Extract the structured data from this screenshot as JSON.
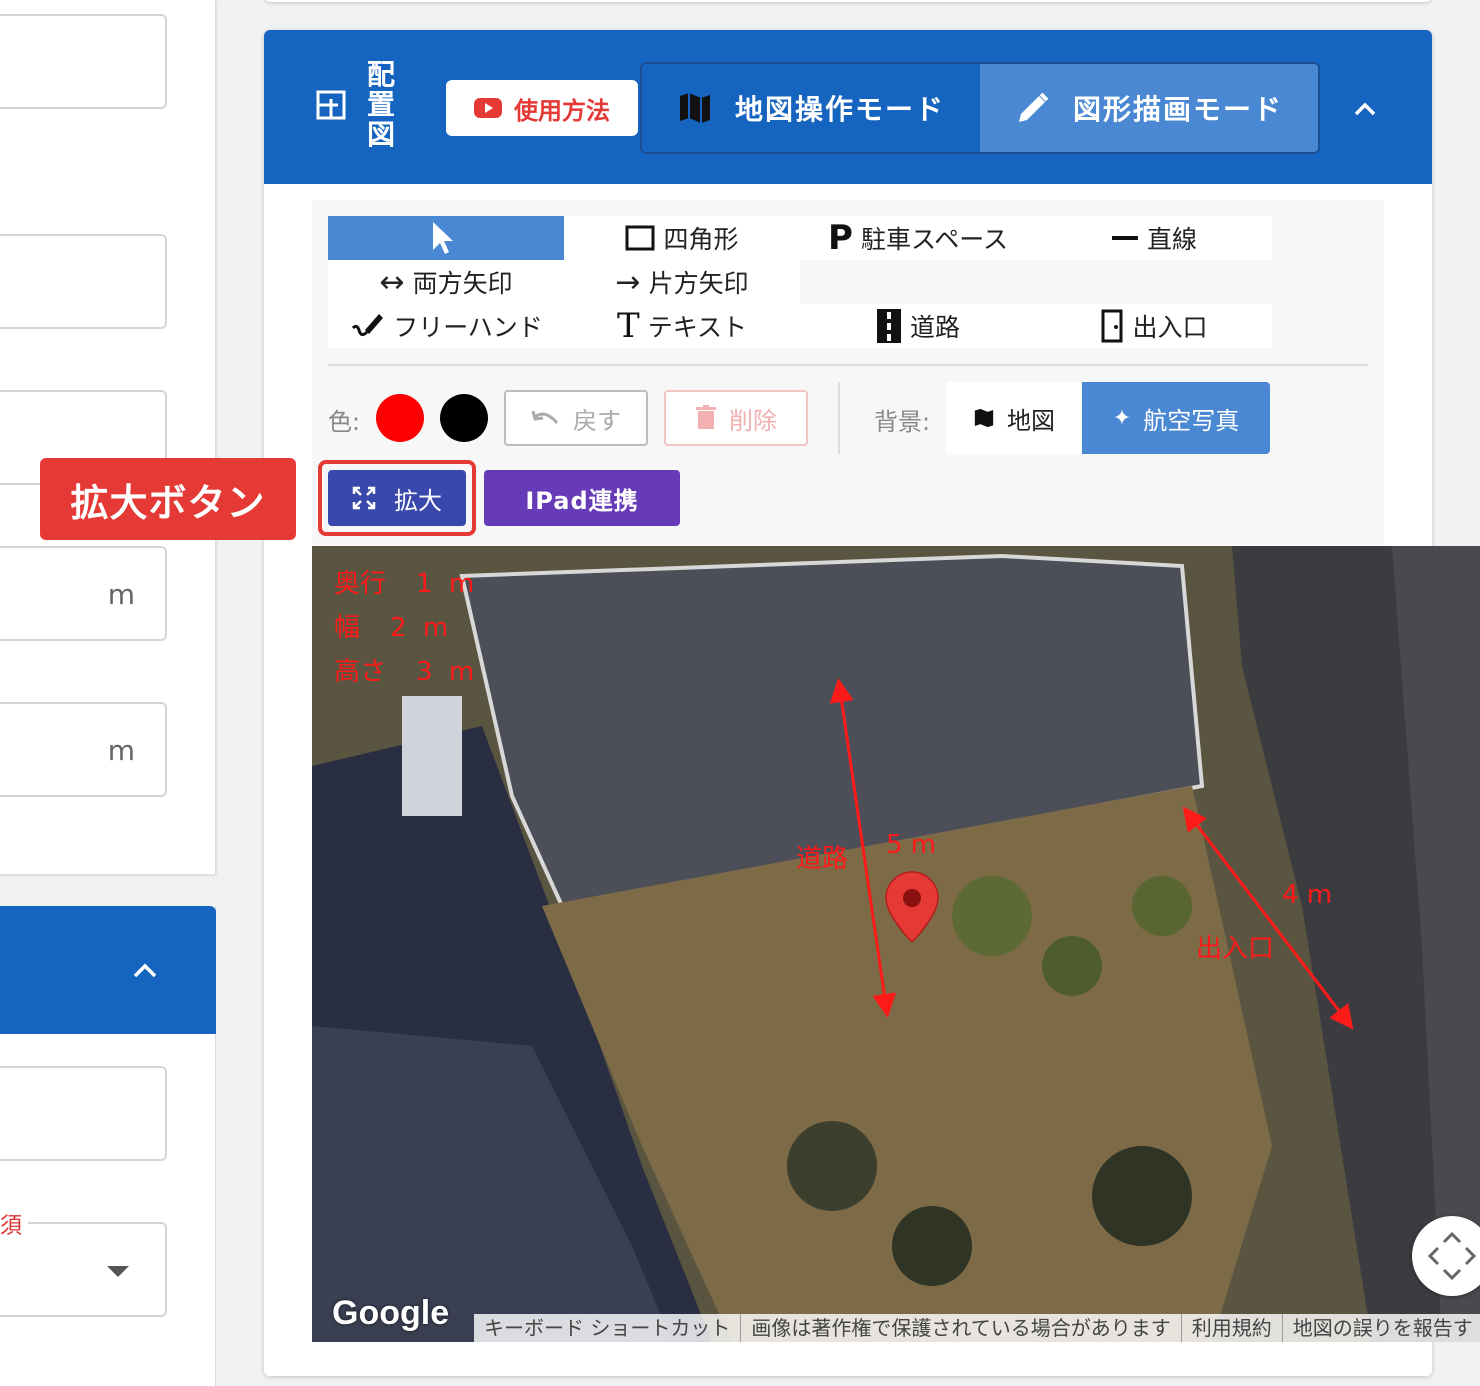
{
  "left": {
    "fields": [
      {
        "unit": ""
      },
      {
        "unit": ""
      },
      {
        "unit": ""
      },
      {
        "unit": "m"
      },
      {
        "unit": "m"
      }
    ],
    "required_label": "須"
  },
  "header": {
    "title": "配置図",
    "howto_label": "使用方法",
    "modes": [
      {
        "label": "地図操作モード",
        "icon": "map-icon",
        "active": false
      },
      {
        "label": "図形描画モード",
        "icon": "pencil-icon",
        "active": true
      }
    ]
  },
  "tools": {
    "row1": [
      "",
      "四角形",
      "駐車スペース",
      "直線"
    ],
    "row2": [
      "両方矢印",
      "片方矢印"
    ],
    "row3": [
      "フリーハンド",
      "テキスト",
      "道路",
      "出入口"
    ]
  },
  "controls": {
    "color_label": "色:",
    "colors": [
      "#ff0000",
      "#000000"
    ],
    "undo_label": "戻す",
    "delete_label": "削除",
    "background_label": "背景:",
    "bg_options": [
      {
        "label": "地図",
        "active": false
      },
      {
        "label": "航空写真",
        "active": true
      }
    ],
    "zoom_label": "拡大",
    "ipad_label": "IPad連携"
  },
  "callout": "拡大ボタン",
  "map": {
    "dims": [
      {
        "label": "奥行",
        "value": "1 m"
      },
      {
        "label": "幅",
        "value": "2 m"
      },
      {
        "label": "高さ",
        "value": "3 m"
      }
    ],
    "annotations": {
      "road_label": "道路",
      "road_length": "5 m",
      "entrance_label": "出入口",
      "entrance_length": "4 m"
    },
    "logo": "Google",
    "attribution": [
      "キーボード ショートカット",
      "画像は著作権で保護されている場合があります",
      "利用規約",
      "地図の誤りを報告す"
    ]
  }
}
